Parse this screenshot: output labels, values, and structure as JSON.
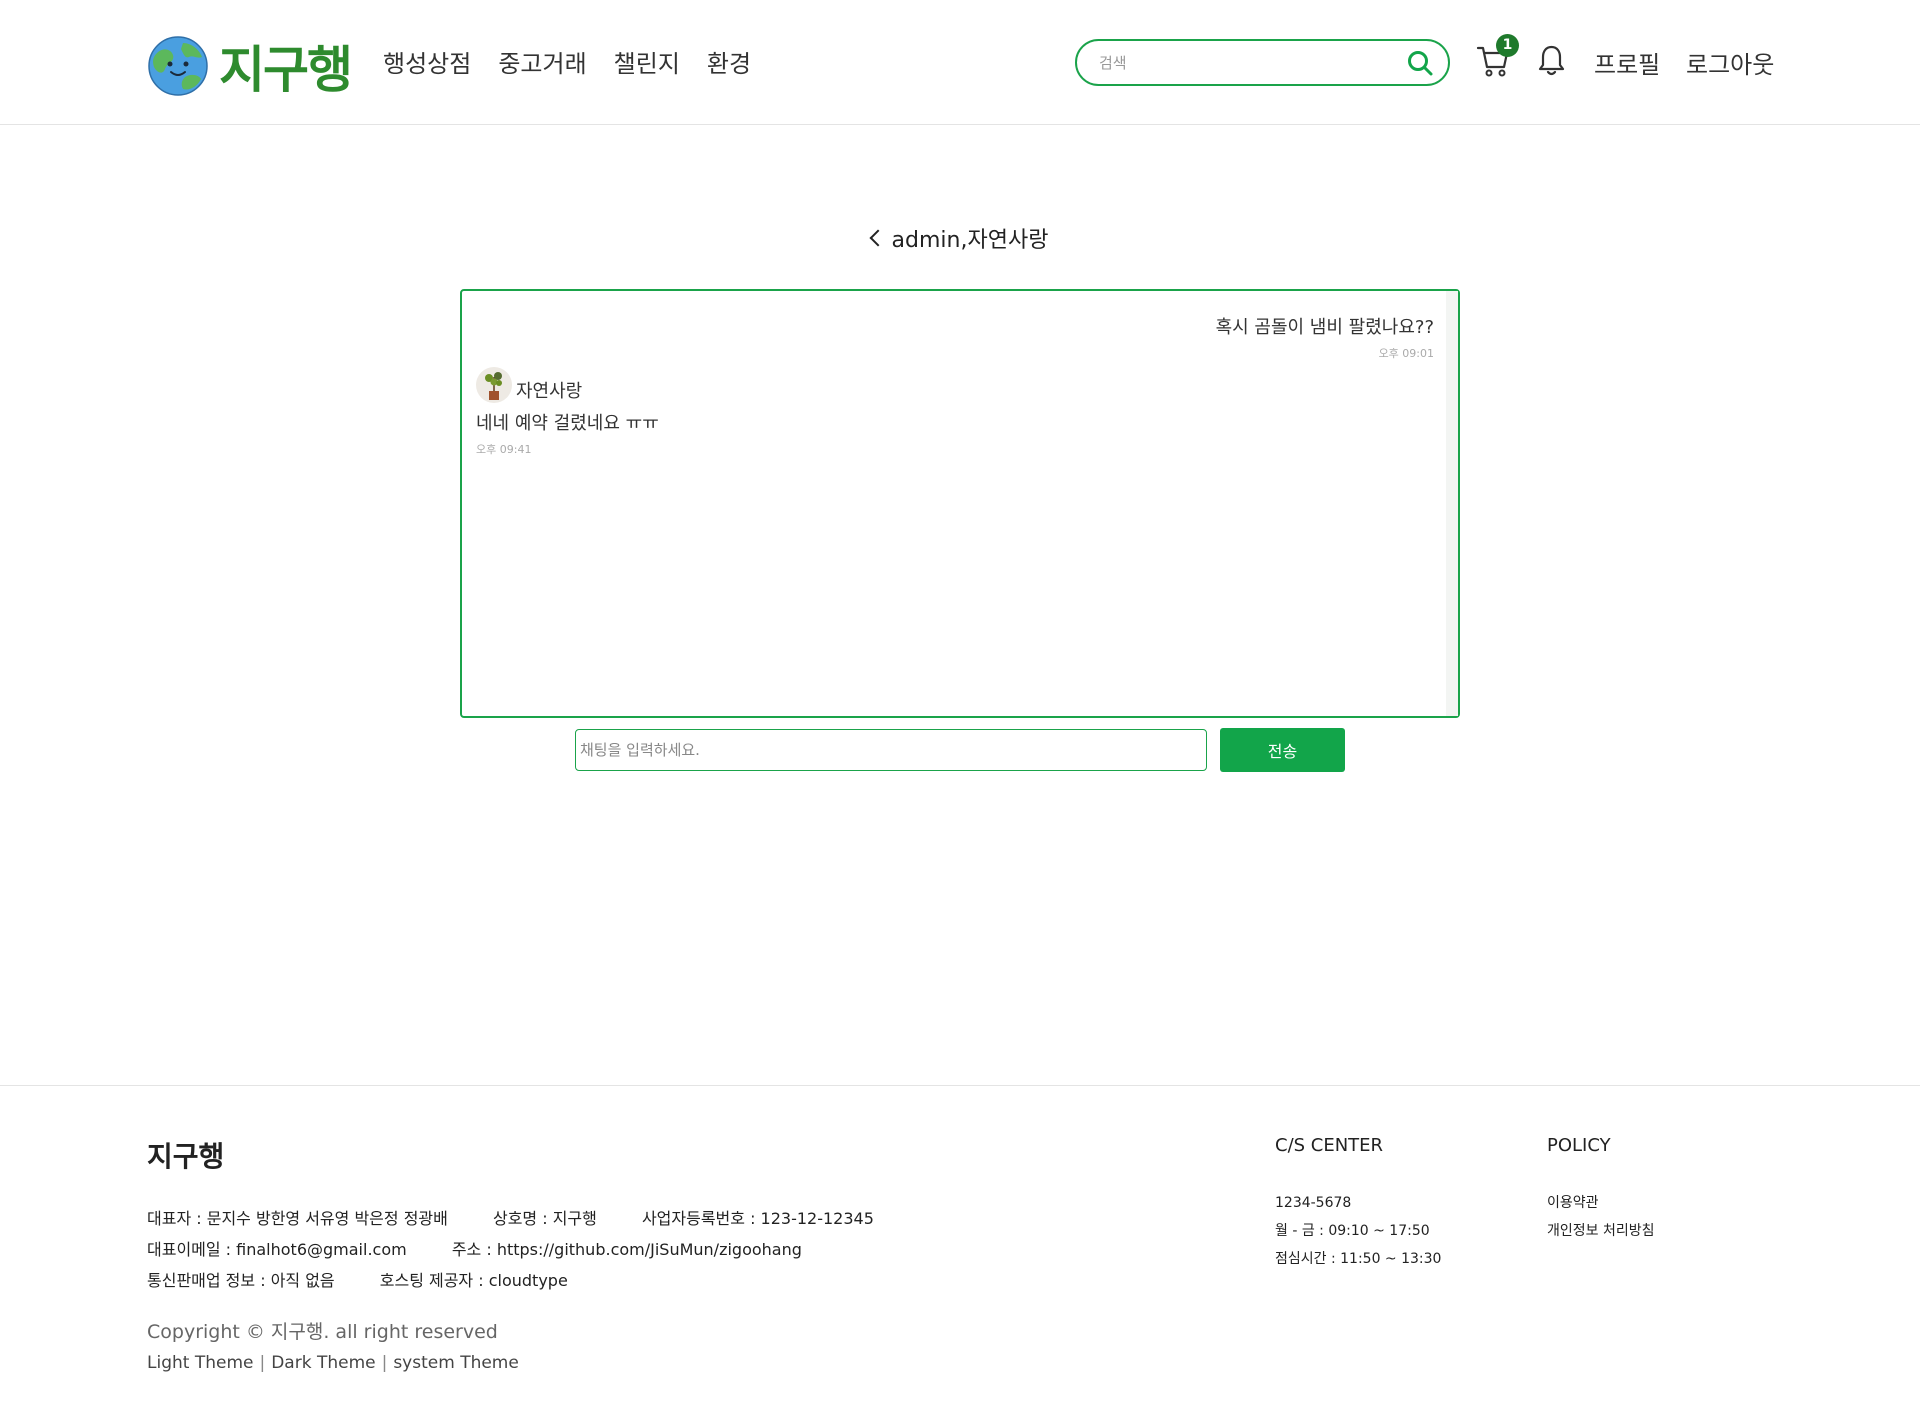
{
  "header": {
    "logo_text": "지구행",
    "nav": [
      "행성상점",
      "중고거래",
      "챌린지",
      "환경"
    ],
    "search": {
      "placeholder": "검색",
      "value": ""
    },
    "cart_badge": "1",
    "profile_label": "프로필",
    "logout_label": "로그아웃"
  },
  "chat": {
    "title": "admin,자연사랑",
    "messages": [
      {
        "side": "right",
        "text": "혹시 곰돌이 냄비 팔렸나요??",
        "time": "오후 09:01"
      },
      {
        "side": "left",
        "sender": "자연사랑",
        "text": "네네 예약 걸렸네요 ㅠㅠ",
        "time": "오후 09:41"
      }
    ],
    "input_placeholder": "채팅을 입력하세요.",
    "send_label": "전송"
  },
  "footer": {
    "brand": "지구행",
    "info_rows": [
      [
        "대표자 : 문지수 방한영 서유영 박은정 정광배",
        "상호명 : 지구행",
        "사업자등록번호 : 123-12-12345"
      ],
      [
        "대표이메일 : finalhot6@gmail.com",
        "주소 : https://github.com/JiSuMun/zigoohang"
      ],
      [
        "통신판매업 정보 : 아직 없음",
        "호스팅 제공자 : cloudtype"
      ]
    ],
    "copyright": "Copyright © 지구행. all right reserved",
    "themes": [
      "Light Theme",
      "Dark Theme",
      "system Theme"
    ],
    "cs": {
      "title": "C/S CENTER",
      "phone": "1234-5678",
      "hours": "월 - 금 : 09:10 ~ 17:50",
      "lunch": "점심시간 : 11:50 ~ 13:30"
    },
    "policy": {
      "title": "POLICY",
      "terms": "이용약관",
      "privacy": "개인정보 처리방침"
    }
  },
  "colors": {
    "accent": "#12a54a",
    "logo_green": "#2e8b2e",
    "badge": "#1f7a2c"
  },
  "icons": [
    "globe-logo-icon",
    "search-icon",
    "cart-icon",
    "bell-icon",
    "chevron-left-icon",
    "avatar-plant-icon"
  ]
}
